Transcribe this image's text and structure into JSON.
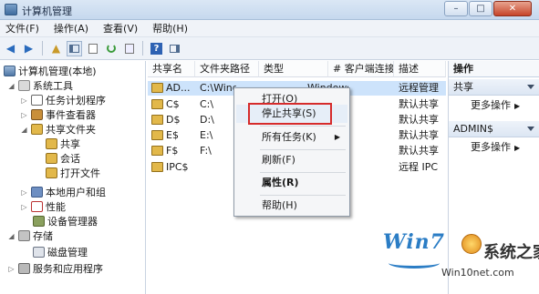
{
  "window": {
    "title": "计算机管理",
    "minimize": "–",
    "maximize": "□",
    "close": "✕"
  },
  "menu": [
    "文件(F)",
    "操作(A)",
    "查看(V)",
    "帮助(H)"
  ],
  "toolbar": {
    "back_glyph": "◀",
    "forward_glyph": "▶",
    "up_glyph": "▲",
    "help_glyph": "?"
  },
  "tree": {
    "root": "计算机管理(本地)",
    "items": [
      {
        "label": "系统工具",
        "expanded": true
      },
      {
        "label": "任务计划程序"
      },
      {
        "label": "事件查看器"
      },
      {
        "label": "共享文件夹",
        "expanded": true
      },
      {
        "label": "共享"
      },
      {
        "label": "会话"
      },
      {
        "label": "打开文件"
      },
      {
        "label": "本地用户和组"
      },
      {
        "label": "性能"
      },
      {
        "label": "设备管理器"
      },
      {
        "label": "存储",
        "expanded": true
      },
      {
        "label": "磁盘管理"
      },
      {
        "label": "服务和应用程序"
      }
    ]
  },
  "list": {
    "columns": [
      "共享名",
      "文件夹路径",
      "类型",
      "# 客户端连接",
      "描述"
    ],
    "rows": [
      {
        "name": "AD...",
        "path": "C:\\Wind",
        "type": "Windows",
        "desc": "远程管理"
      },
      {
        "name": "C$",
        "path": "C:\\",
        "type": "",
        "desc": "默认共享"
      },
      {
        "name": "D$",
        "path": "D:\\",
        "type": "",
        "desc": "默认共享"
      },
      {
        "name": "E$",
        "path": "E:\\",
        "type": "",
        "desc": "默认共享"
      },
      {
        "name": "F$",
        "path": "F:\\",
        "type": "",
        "desc": "默认共享"
      },
      {
        "name": "IPC$",
        "path": "",
        "type": "",
        "desc": "远程 IPC"
      }
    ]
  },
  "context_menu": {
    "items": [
      {
        "label": "打开(O)"
      },
      {
        "label": "停止共享(S)",
        "highlighted": true
      },
      {
        "label": "所有任务(K)",
        "submenu": "▶"
      },
      {
        "label": "刷新(F)"
      },
      {
        "label": "属性(R)",
        "bold": true
      },
      {
        "label": "帮助(H)"
      }
    ]
  },
  "actions": {
    "header": "操作",
    "sections": [
      {
        "title": "共享",
        "more": "更多操作"
      },
      {
        "title": "ADMIN$",
        "more": "更多操作"
      }
    ],
    "more_arrow": "▶"
  },
  "watermark": {
    "logo": "Win7",
    "site_cn": "系统之家",
    "url": "Win10net.com"
  }
}
